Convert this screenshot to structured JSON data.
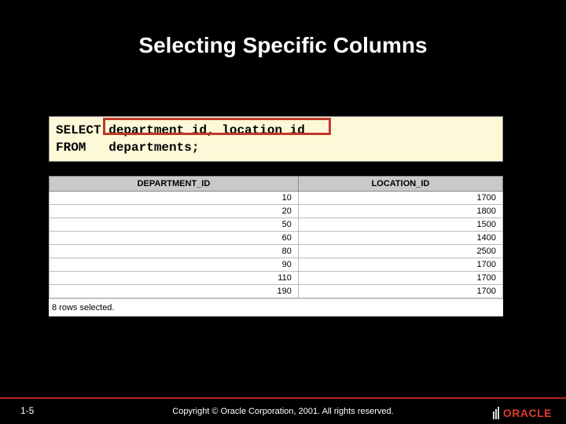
{
  "title": "Selecting Specific Columns",
  "sql": {
    "line1_kw": "SELECT ",
    "line1_cols": "department_id, location_id",
    "line2_kw": "FROM   ",
    "line2_tbl": "departments;"
  },
  "table": {
    "headers": [
      "DEPARTMENT_ID",
      "LOCATION_ID"
    ],
    "rows": [
      [
        "10",
        "1700"
      ],
      [
        "20",
        "1800"
      ],
      [
        "50",
        "1500"
      ],
      [
        "60",
        "1400"
      ],
      [
        "80",
        "2500"
      ],
      [
        "90",
        "1700"
      ],
      [
        "110",
        "1700"
      ],
      [
        "190",
        "1700"
      ]
    ],
    "rowcount": "8 rows selected."
  },
  "footer": {
    "page": "1-5",
    "copyright": "Copyright © Oracle Corporation, 2001. All rights reserved.",
    "logo": "ORACLE"
  },
  "chart_data": {
    "type": "table",
    "title": "Selecting Specific Columns",
    "headers": [
      "DEPARTMENT_ID",
      "LOCATION_ID"
    ],
    "rows": [
      [
        10,
        1700
      ],
      [
        20,
        1800
      ],
      [
        50,
        1500
      ],
      [
        60,
        1400
      ],
      [
        80,
        2500
      ],
      [
        90,
        1700
      ],
      [
        110,
        1700
      ],
      [
        190,
        1700
      ]
    ]
  }
}
